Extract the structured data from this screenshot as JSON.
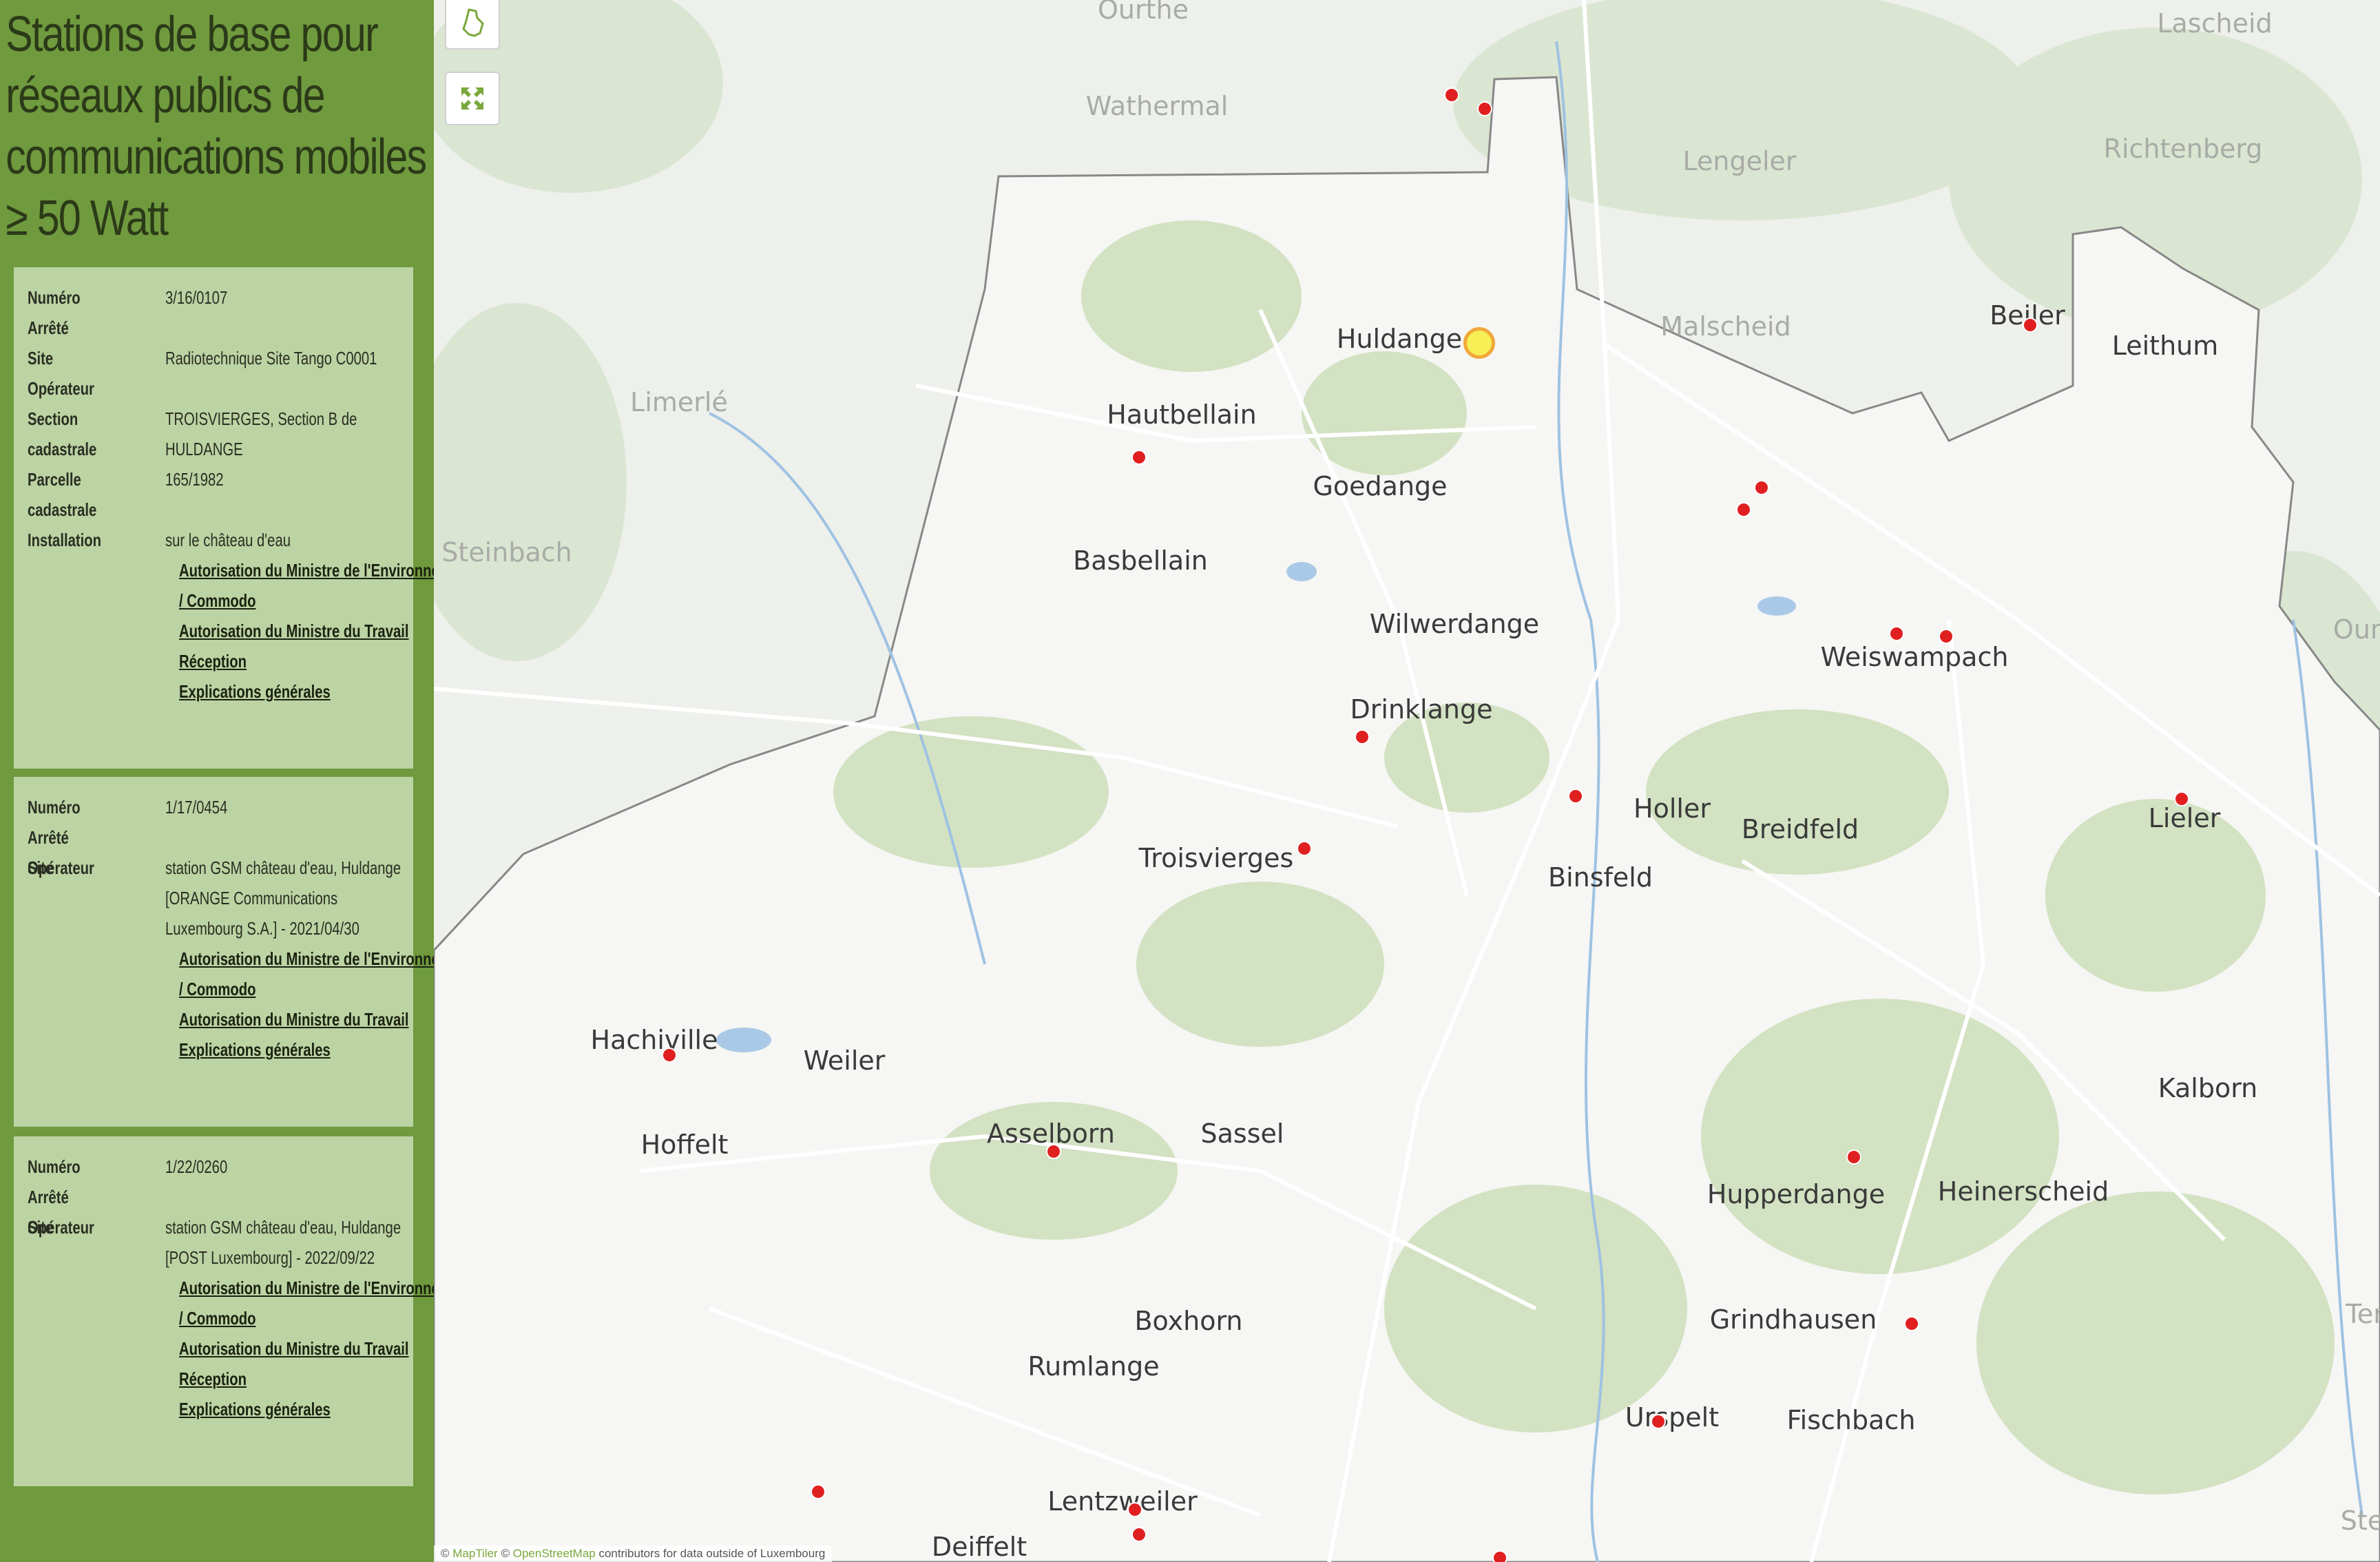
{
  "panel": {
    "title": "Stations de base pour réseaux publics de communications mobiles ≥ 50 Watt",
    "labels": {
      "numero": "Numéro",
      "arrete": "Arrêté",
      "site": "Site",
      "operateur": "Opérateur",
      "section": "Section cadastrale",
      "parcelle": "Parcelle cadastrale",
      "installation": "Installation"
    },
    "cards": [
      {
        "numero": "3/16/0107",
        "site": "Radiotechnique Site Tango C0001",
        "section": "TROISVIERGES, Section B de HULDANGE",
        "parcelle": "165/1982",
        "installation": "sur le château d'eau",
        "links": [
          "Autorisation du Ministre de l'Environnement / Commodo",
          "Autorisation du Ministre du Travail",
          "Réception",
          "Explications générales"
        ]
      },
      {
        "numero": "1/17/0454",
        "site": "station GSM château d'eau, Huldange [ORANGE Communications Luxembourg S.A.] - 2021/04/30",
        "links": [
          "Autorisation du Ministre de l'Environnement / Commodo",
          "Autorisation du Ministre du Travail",
          "Explications générales"
        ]
      },
      {
        "numero": "1/22/0260",
        "site": "station GSM château d'eau, Huldange [POST Luxembourg] - 2022/09/22",
        "links": [
          "Autorisation du Ministre de l'Environnement / Commodo",
          "Autorisation du Ministre du Travail",
          "Réception",
          "Explications générales"
        ]
      }
    ]
  },
  "map": {
    "controls": [
      "luxembourg-outline-icon",
      "fullscreen-icon"
    ],
    "places": [
      "Huldange",
      "Hautbellain",
      "Goedange",
      "Basbellain",
      "Wilwerdange",
      "Drinklange",
      "Troisvierges",
      "Holler",
      "Breidfeld",
      "Binsfeld",
      "Weiswampach",
      "Beiler",
      "Leithum",
      "Lieler",
      "Hachiville",
      "Weiler",
      "Hoffelt",
      "Asselborn",
      "Sassel",
      "Kalborn",
      "Hupperdange",
      "Heinerscheid",
      "Boxhorn",
      "Rumlange",
      "Grindhausen",
      "Urspelt",
      "Fischbach",
      "Lentzweiler",
      "Deiffelt"
    ],
    "foreign_places": [
      "Ourthe",
      "Wathermal",
      "Lascheid",
      "Lengeler",
      "Richtenberg",
      "Malscheid",
      "Limerlé",
      "Steinbach",
      "Oure",
      "Ter",
      "Ste"
    ],
    "attribution": {
      "prefix": "© ",
      "maptiler": "MapTiler",
      "sep": " © ",
      "osm": "OpenStreetMap",
      "suffix": " contributors for data outside of Luxembourg"
    }
  }
}
